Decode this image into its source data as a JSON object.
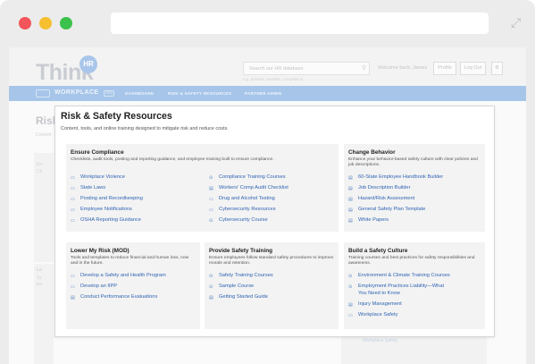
{
  "site": {
    "logo_text": "Think",
    "logo_badge": "HR",
    "search_placeholder": "Search our HR database",
    "search_sub": "e.g. policies, benefits, compliance",
    "welcome": "Welcome back, James",
    "profile_label": "Profile",
    "logout_label": "Log Out",
    "gear_glyph": "⚙"
  },
  "nav": {
    "brand": "WORKPLACE",
    "badge": "PRO",
    "items": [
      "DASHBOARD",
      "RISK & SAFETY RESOURCES",
      "PARTNER ADMIN"
    ]
  },
  "background": {
    "title": "Risk",
    "subtitle": "Content",
    "text_a": "En",
    "text_b": "Ch",
    "text_c": "Lo",
    "text_d": "To",
    "text_e": "los",
    "link_a": "Workplace Safety"
  },
  "panel": {
    "title": "Risk & Safety Resources",
    "description": "Content, tools, and online training designed to mitigate risk and reduce costs.",
    "cards": [
      {
        "title": "Ensure Compliance",
        "description": "Checklists, audit tools, posting and reporting guidance, and employee training built to ensure compliance.",
        "col1": [
          "Workplace Violence",
          "State Laws",
          "Posting and Recordkeeping",
          "Employee Notifications",
          "OSHA Reporting Guidance"
        ],
        "col2": [
          "Compliance Training Courses",
          "Workers' Comp Audit Checklist",
          "Drug and Alcohol Testing",
          "Cybersecurity Resources",
          "Cybersecurity Course"
        ]
      },
      {
        "title": "Change Behavior",
        "description": "Enhance your behavior-based safety culture with clear policies and job descriptions.",
        "links": [
          "60-State Employee Handbook Builder",
          "Job Description Builder",
          "Hazard/Risk Assessment",
          "General Safety Plan Template",
          "White Papers"
        ]
      },
      {
        "title": "Lower My Risk (MOD)",
        "description": "Tools and templates to reduce financial and human loss, now and in the future.",
        "links": [
          "Develop a Safety and Health Program",
          "Develop an IIPP",
          "Conduct Performance Evaluations"
        ]
      },
      {
        "title": "Provide Safety Training",
        "description": "Ensure employees follow standard safety procedures to improve morale and retention.",
        "links": [
          "Safety Training Courses",
          "Sample Course",
          "Getting Started Guide"
        ]
      },
      {
        "title": "Build a Safety Culture",
        "description": "Training courses and best practices for safety responsibilities and awareness.",
        "links": [
          "Environment & Climate Training Courses",
          "Employment Practices Liability—What You Need to Know",
          "Injury Management",
          "Workplace Safety"
        ]
      }
    ]
  },
  "icons": {
    "play": "⊙",
    "doc": "▤",
    "list": "▭"
  },
  "colors": {
    "nav_bar": "#a6c5e9",
    "link": "#2f64b3",
    "card_bg": "#f3f3f3"
  }
}
